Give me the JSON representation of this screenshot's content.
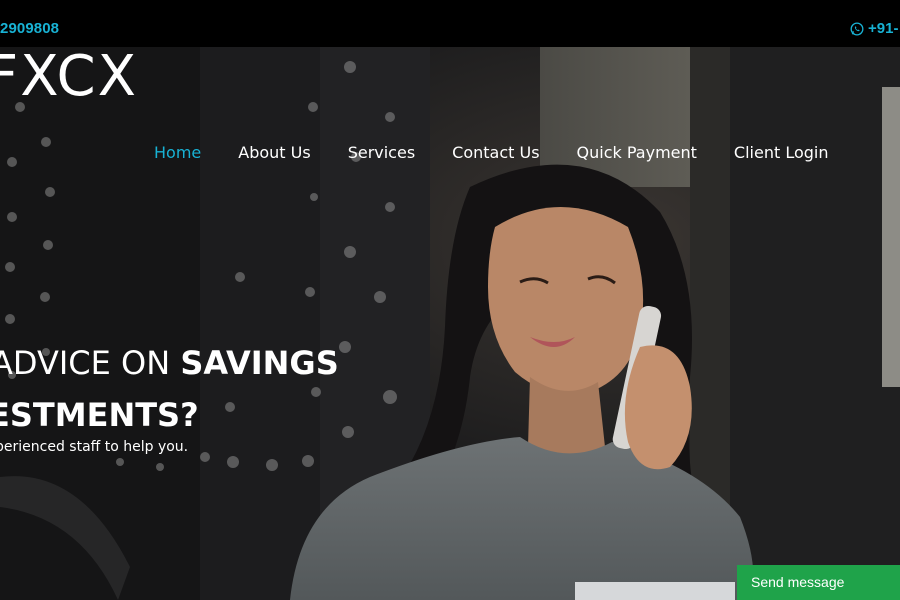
{
  "topbar": {
    "phone_left": "2909808",
    "phone_right": "+91-",
    "whatsapp_icon": "whatsapp-icon",
    "accent": "#18b2d4"
  },
  "logo": {
    "text": "FXCX"
  },
  "nav": {
    "items": [
      {
        "label": "Home",
        "active": true
      },
      {
        "label": "About Us"
      },
      {
        "label": "Services"
      },
      {
        "label": "Contact Us"
      },
      {
        "label": "Quick Payment"
      },
      {
        "label": "Client Login"
      }
    ],
    "active_color": "#18b2d4"
  },
  "hero": {
    "line1_regular": "ADVICE ON ",
    "line1_bold": "SAVINGS",
    "line2_bold": "ESTMENTS?",
    "subtext": "perienced staff to help you."
  },
  "chat": {
    "label": "Send message",
    "color": "#1fa34a"
  }
}
